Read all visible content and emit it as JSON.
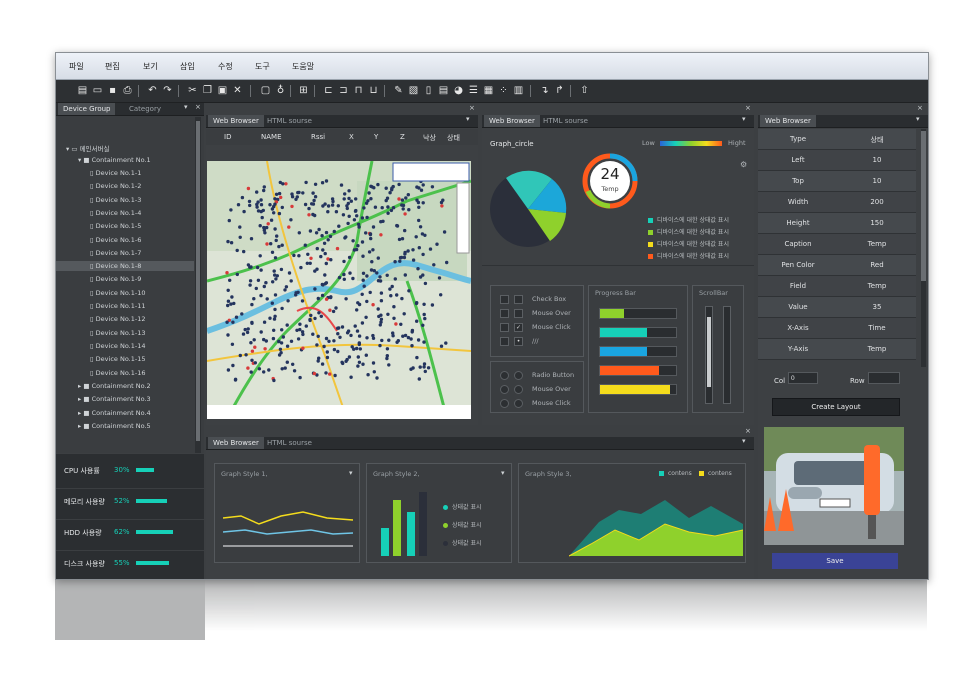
{
  "menu": {
    "items": [
      "파일",
      "편집",
      "보기",
      "삽입",
      "수정",
      "도구",
      "도움말"
    ]
  },
  "toolbar": {
    "icons": [
      "new-icon",
      "open-icon",
      "save-icon",
      "print-icon",
      "undo-icon",
      "redo-icon",
      "cut-icon",
      "copy-icon",
      "paste-icon",
      "delete-icon",
      "monitor-icon",
      "bulb-icon",
      "grid-icon",
      "align-left-icon",
      "align-right-icon",
      "align-top-icon",
      "align-bottom-icon",
      "pencil-icon",
      "image-icon",
      "text-icon",
      "doc-icon",
      "pie-icon",
      "list-icon",
      "table-icon",
      "scatter-icon",
      "chart-icon",
      "down-arrow-icon",
      "up-arrow-icon",
      "upload-icon"
    ]
  },
  "left_panel": {
    "tabs": [
      "Device Group",
      "Category"
    ],
    "root": "메인서버실",
    "containment_1": "Containment No.1",
    "devices": [
      "Device No.1-1",
      "Device No.1-2",
      "Device No.1-3",
      "Device No.1-4",
      "Device No.1-5",
      "Device No.1-6",
      "Device No.1-7",
      "Device No.1-8",
      "Device No.1-9",
      "Device No.1-10",
      "Device No.1-11",
      "Device No.1-12",
      "Device No.1-13",
      "Device No.1-14",
      "Device No.1-15",
      "Device No.1-16"
    ],
    "containments": [
      "Containment No.2",
      "Containment No.3",
      "Containment No.4",
      "Containment No.5"
    ]
  },
  "metrics": [
    {
      "label": "CPU 사용률",
      "value": "30%",
      "fraction": 0.3,
      "color": "#16d0b8"
    },
    {
      "label": "메모리 사용량",
      "value": "52%",
      "fraction": 0.52,
      "color": "#16d0b8"
    },
    {
      "label": "HDD 사용량",
      "value": "62%",
      "fraction": 0.62,
      "color": "#16d0b8"
    },
    {
      "label": "디스크 사용량",
      "value": "55%",
      "fraction": 0.55,
      "color": "#16d0b8"
    }
  ],
  "map_panel": {
    "tabs": [
      "Web Browser",
      "HTML sourse"
    ],
    "columns": [
      "ID",
      "NAME",
      "Rssi",
      "X",
      "Y",
      "Z",
      "낙상",
      "상태"
    ]
  },
  "graph_panel": {
    "tabs": [
      "Web Browser",
      "HTML sourse"
    ],
    "title": "Graph_circle",
    "low": "Low",
    "high": "Hight",
    "gauge_value": "24",
    "gauge_label": "Temp",
    "legend": [
      {
        "text": "디바이스에 대한 상태값 표시",
        "color": "#16d0b8"
      },
      {
        "text": "디바이스에 대한 상태값 표시",
        "color": "#8fd12c"
      },
      {
        "text": "디바이스에 대한 상태값 표시",
        "color": "#f4dc1c"
      },
      {
        "text": "디바이스에 대한 상태값 표시",
        "color": "#ff5a1c"
      }
    ],
    "checkbox_items": [
      "Check Box",
      "Mouse Over",
      "Mouse Click",
      "///"
    ],
    "radio_items": [
      "Radio Button",
      "Mouse Over",
      "Mouse Click"
    ],
    "progress_title": "Progress Bar",
    "progress": [
      {
        "fraction": 0.32,
        "color": "#8fd12c"
      },
      {
        "fraction": 0.62,
        "color": "#16d0b8"
      },
      {
        "fraction": 0.62,
        "color": "#1aa5e0"
      },
      {
        "fraction": 0.78,
        "color": "#ff5a1c"
      },
      {
        "fraction": 0.92,
        "color": "#f4dc1c"
      }
    ],
    "scrollbar_title": "ScrollBar"
  },
  "bottom_panel": {
    "tabs": [
      "Web Browser",
      "HTML sourse"
    ],
    "graph1_title": "Graph Style 1,",
    "graph2_title": "Graph Style 2,",
    "graph3_title": "Graph Style 3,",
    "graph2_legend": [
      "상태값 표시",
      "상태값 표시",
      "상태값 표시"
    ],
    "graph3_legend": [
      "contens",
      "contens"
    ]
  },
  "props": {
    "tab": "Web Browser",
    "rows": [
      {
        "key": "Type",
        "value": "상태"
      },
      {
        "key": "Left",
        "value": "10"
      },
      {
        "key": "Top",
        "value": "10"
      },
      {
        "key": "Width",
        "value": "200"
      },
      {
        "key": "Height",
        "value": "150"
      },
      {
        "key": "Caption",
        "value": "Temp"
      },
      {
        "key": "Pen Color",
        "value": "Red"
      },
      {
        "key": "Field",
        "value": "Temp"
      },
      {
        "key": "Value",
        "value": "35"
      },
      {
        "key": "X-Axis",
        "value": "Time"
      },
      {
        "key": "Y-Axis",
        "value": "Temp"
      }
    ],
    "col_label": "Col",
    "col_value": "0",
    "row_label": "Row",
    "create_button": "Create Layout",
    "save_button": "Save"
  },
  "colors": {
    "accent": "#16d0b8",
    "save_button": "#3a4396",
    "background": "#3d4043"
  }
}
